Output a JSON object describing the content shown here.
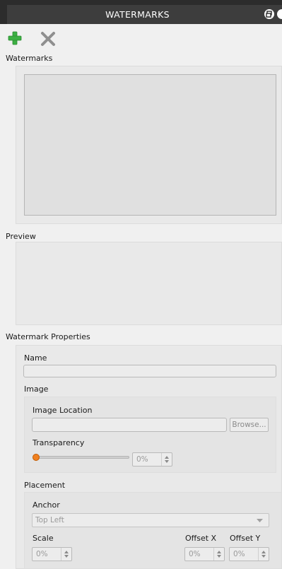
{
  "panel": {
    "title": "WATERMARKS"
  },
  "toolbar": {
    "add_icon": "plus-icon",
    "remove_icon": "x-icon",
    "add_color": "#3cb043",
    "remove_color": "#8f8f8f"
  },
  "sections": {
    "watermarks_label": "Watermarks",
    "preview_label": "Preview",
    "properties_label": "Watermark Properties"
  },
  "properties": {
    "name_label": "Name",
    "name_value": "",
    "image_label": "Image",
    "image_location_label": "Image Location",
    "image_location_value": "",
    "browse_label": "Browse...",
    "transparency_label": "Transparency",
    "transparency_value": "0%",
    "transparency_fraction": 0
  },
  "placement": {
    "label": "Placement",
    "anchor_label": "Anchor",
    "anchor_value": "Top Left",
    "scale_label": "Scale",
    "scale_value": "0%",
    "offset_x_label": "Offset X",
    "offset_x_value": "0%",
    "offset_y_label": "Offset Y",
    "offset_y_value": "0%"
  },
  "colors": {
    "accent": "#f08020",
    "titlebar": "#3d3d3d"
  }
}
